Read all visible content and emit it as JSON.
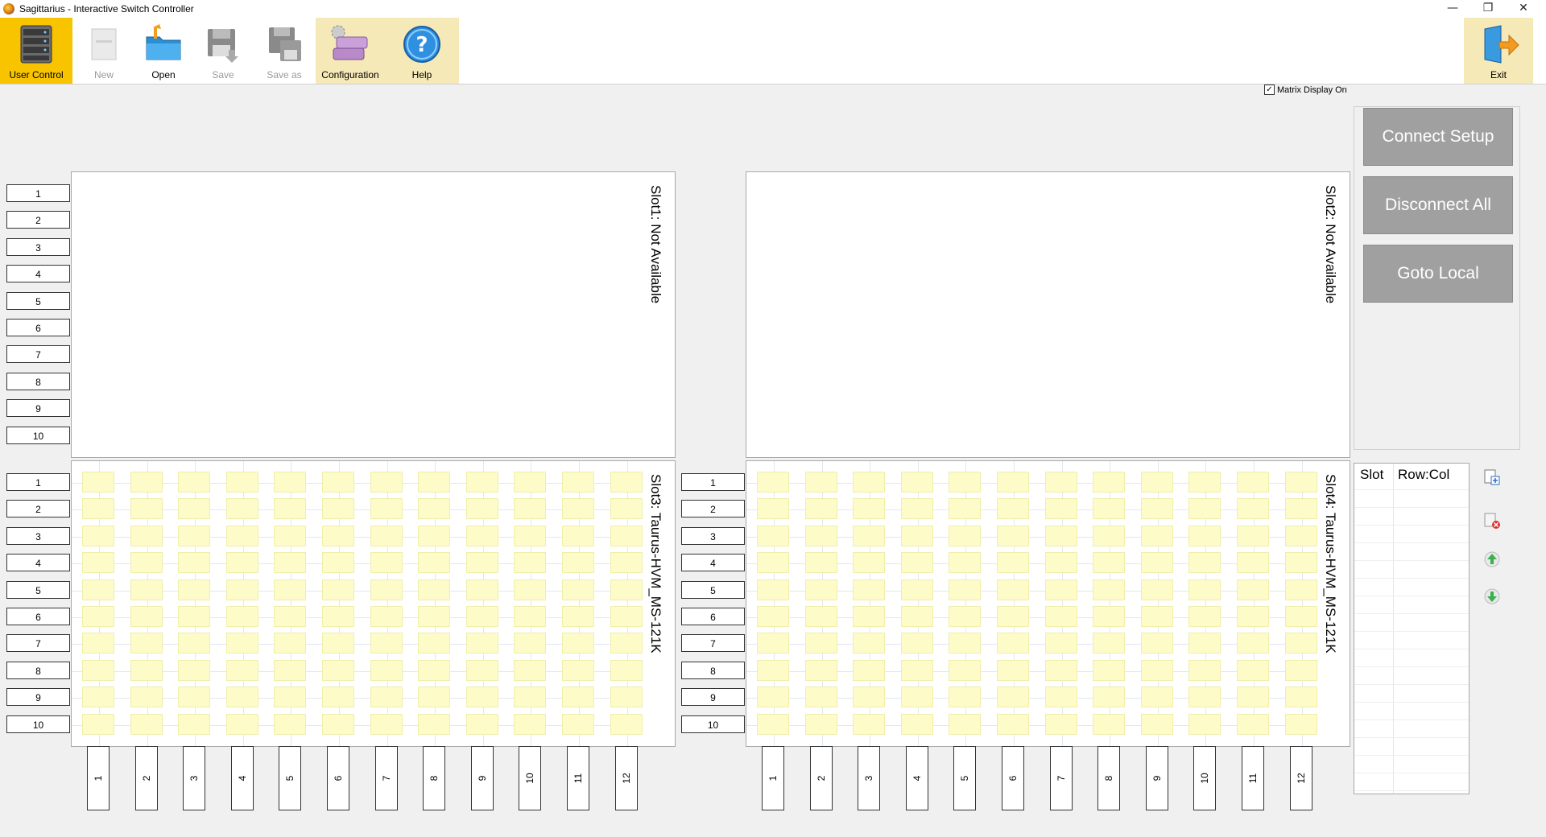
{
  "window": {
    "title": "Sagittarius - Interactive Switch Controller",
    "controls": {
      "minimize": "—",
      "restore": "❐",
      "close": "✕"
    }
  },
  "toolbar": {
    "user_control": "User Control",
    "new": "New",
    "open": "Open",
    "save": "Save",
    "save_as": "Save as",
    "configuration": "Configuration",
    "help": "Help",
    "exit": "Exit"
  },
  "matrix_display": {
    "label": "Matrix Display On",
    "checked": true,
    "mark": "✓"
  },
  "actions": {
    "connect_setup": "Connect Setup",
    "disconnect_all": "Disconnect All",
    "goto_local": "Goto Local"
  },
  "slots": [
    {
      "title": "Slot1: Not Available",
      "available": false
    },
    {
      "title": "Slot2: Not Available",
      "available": false
    },
    {
      "title": "Slot3: Taurus-HVM_MS-121K",
      "available": true
    },
    {
      "title": "Slot4: Taurus-HVM_MS-121K",
      "available": true
    }
  ],
  "row_labels": [
    "1",
    "2",
    "3",
    "4",
    "5",
    "6",
    "7",
    "8",
    "9",
    "10"
  ],
  "col_labels": [
    "1",
    "2",
    "3",
    "4",
    "5",
    "6",
    "7",
    "8",
    "9",
    "10",
    "11",
    "12"
  ],
  "connections_list": {
    "col_slot": "Slot",
    "col_rowcol": "Row:Col",
    "items": []
  },
  "colors": {
    "user_control_active": "#f8c400",
    "toolbar_highlight": "#f6e9b8",
    "cell": "#fdfcc8",
    "action_button": "#a0a0a0"
  },
  "icons": [
    "server-rack-icon",
    "new-document-icon",
    "open-folder-icon",
    "save-disk-icon",
    "save-as-disk-icon",
    "configuration-gear-icon",
    "help-question-icon",
    "exit-door-icon",
    "add-connection-icon",
    "delete-connection-icon",
    "move-up-icon",
    "move-down-icon"
  ]
}
